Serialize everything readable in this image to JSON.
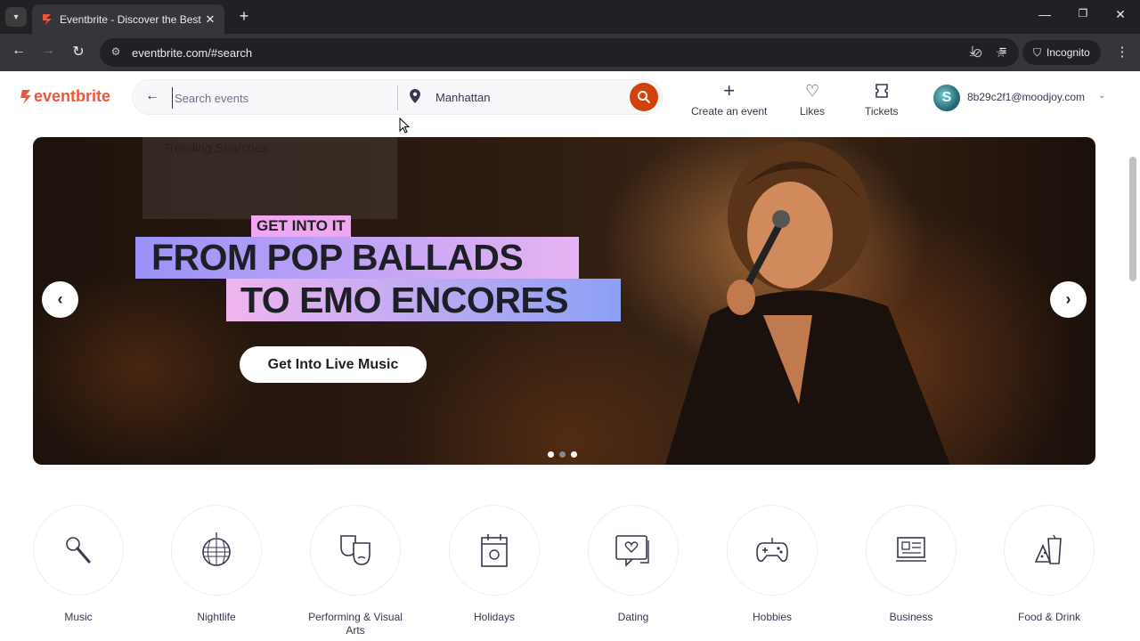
{
  "browser": {
    "tab_title": "Eventbrite - Discover the Best L",
    "url": "eventbrite.com/#search",
    "profile_label": "Incognito"
  },
  "header": {
    "logo_text": "eventbrite",
    "search_placeholder": "Search events",
    "location": "Manhattan",
    "create_label": "Create an event",
    "likes_label": "Likes",
    "tickets_label": "Tickets",
    "avatar_letter": "S",
    "user_email": "8b29c2f1@moodjoy.com"
  },
  "dropdown": {
    "trending_label": "Trending Searches"
  },
  "hero": {
    "kicker": "GET INTO IT",
    "line1": "FROM POP BALLADS",
    "line2": "TO EMO ENCORES",
    "cta": "Get Into Live Music",
    "slide_count": 3,
    "active_slide": 1
  },
  "categories": [
    {
      "label": "Music",
      "icon": "microphone-icon"
    },
    {
      "label": "Nightlife",
      "icon": "disco-ball-icon"
    },
    {
      "label": "Performing & Visual Arts",
      "icon": "theater-masks-icon"
    },
    {
      "label": "Holidays",
      "icon": "calendar-icon"
    },
    {
      "label": "Dating",
      "icon": "chat-heart-icon"
    },
    {
      "label": "Hobbies",
      "icon": "gamepad-icon"
    },
    {
      "label": "Business",
      "icon": "presentation-icon"
    },
    {
      "label": "Food & Drink",
      "icon": "food-drink-icon"
    }
  ],
  "colors": {
    "brand": "#f05537",
    "search_button": "#d1410c",
    "text": "#39364f"
  }
}
